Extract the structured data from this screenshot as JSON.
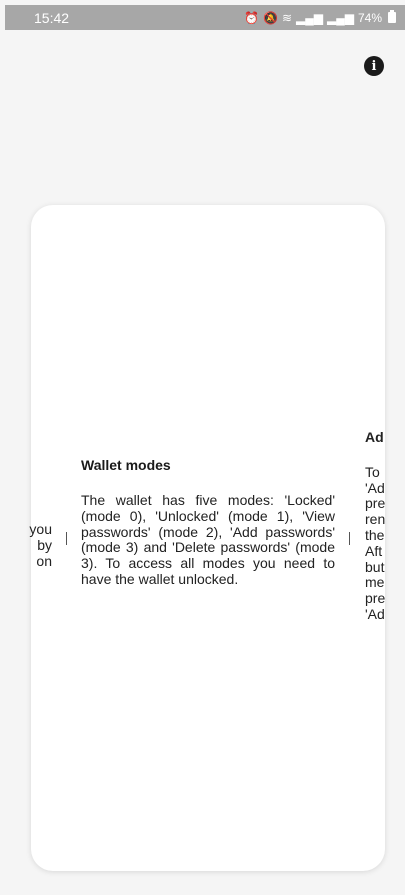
{
  "status_bar": {
    "time": "15:42",
    "icons": [
      "alarm-icon",
      "mute-icon",
      "wifi-icon",
      "signal-icon",
      "signal-icon"
    ],
    "battery_text": "74%"
  },
  "header": {
    "info_icon": "info-icon",
    "info_glyph": "i"
  },
  "carousel": {
    "prev_peek_lines": [
      "you",
      "by",
      "on"
    ],
    "current": {
      "title": "Wallet modes",
      "body": "The wallet has five modes: 'Locked' (mode 0), 'Unlocked' (mode 1), 'View passwords' (mode 2), 'Add passwords' (mode 3) and 'Delete passwords' (mode 3). To access all modes you need to have the wallet unlocked."
    },
    "next_peek": {
      "title": "Ad",
      "lines": [
        "To",
        "'Ad",
        "pre",
        "ren",
        "the",
        "Aft",
        "but",
        "me",
        "pre",
        "'Ad"
      ]
    }
  }
}
